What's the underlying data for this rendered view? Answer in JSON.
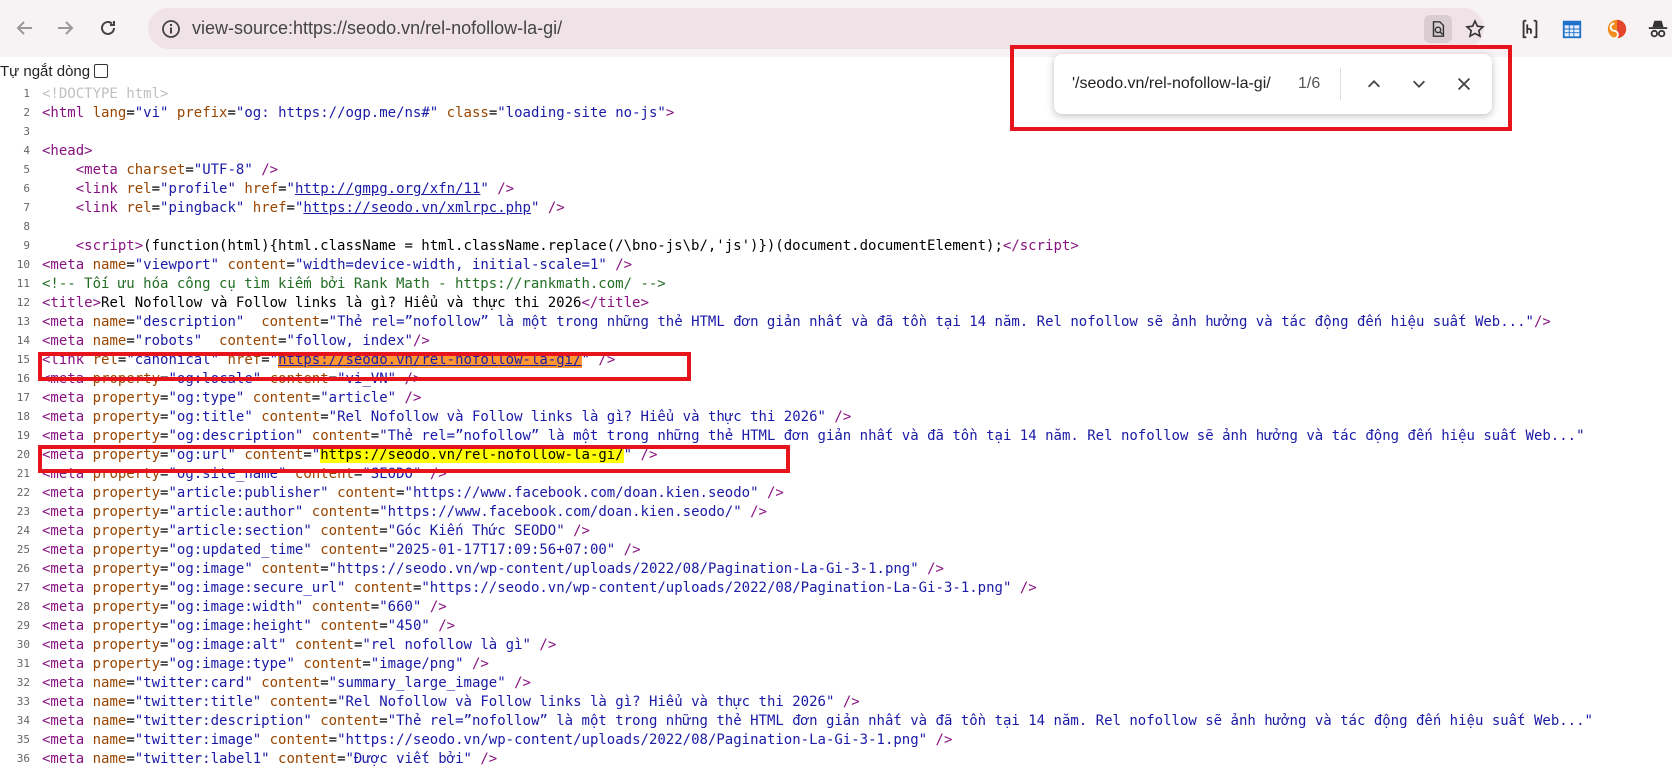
{
  "browser": {
    "url": "view-source:https://seodo.vn/rel-nofollow-la-gi/"
  },
  "wrap": {
    "label": "Tự ngắt dòng"
  },
  "find_bar": {
    "query": "'/seodo.vn/rel-nofollow-la-gi/",
    "count": "1/6"
  },
  "source": {
    "line_numbers": [
      "1",
      "2",
      "3",
      "4",
      "5",
      "6",
      "7",
      "8",
      "9",
      "10",
      "11",
      "12",
      "13",
      "14",
      "15",
      "16",
      "17",
      "18",
      "19",
      "20",
      "21",
      "22",
      "23",
      "24",
      "25",
      "26",
      "27",
      "28",
      "29",
      "30",
      "31",
      "32",
      "33",
      "34",
      "35",
      "36"
    ],
    "l1": "<!DOCTYPE html>",
    "l2_lang": "\"vi\"",
    "l2_prefix": "\"og: https://ogp.me/ns#\"",
    "l2_class": "\"loading-site no-js\"",
    "l5_charset": "\"UTF-8\"",
    "l6_rel": "\"profile\"",
    "l6_href": "http://gmpg.org/xfn/11",
    "l7_rel": "\"pingback\"",
    "l7_href": "https://seodo.vn/xmlrpc.php",
    "l9_script": "(function(html){html.className = html.className.replace(/\\bno-js\\b/,'js')})(document.documentElement);",
    "l10_name": "\"viewport\"",
    "l10_content": "\"width=device-width, initial-scale=1\"",
    "l11_comment": "<!-- Tối ưu hóa công cụ tìm kiếm bởi Rank Math - https://rankmath.com/ -->",
    "l12_title": "Rel Nofollow và Follow links là gì? Hiểu và thực thi 2026",
    "l13_name": "\"description\"",
    "l13_content": "\"Thẻ rel=”nofollow” là một trong những thẻ HTML đơn giản nhất và đã tồn tại 14 năm. Rel nofollow sẽ ảnh hưởng và tác động đến hiệu suất Web...\"",
    "l14_name": "\"robots\"",
    "l14_content": "\"follow, index\"",
    "l15_rel": "\"canonical\"",
    "l15_href": "https://seodo.vn/rel-nofollow-la-gi/",
    "l16_prop": "\"og:locale\"",
    "l16_content": "\"vi_VN\"",
    "l17_prop": "\"og:type\"",
    "l17_content": "\"article\"",
    "l18_prop": "\"og:title\"",
    "l18_content": "\"Rel Nofollow và Follow links là gì? Hiểu và thực thi 2026\"",
    "l19_prop": "\"og:description\"",
    "l19_content": "\"Thẻ rel=”nofollow” là một trong những thẻ HTML đơn giản nhất và đã tồn tại 14 năm. Rel nofollow sẽ ảnh hưởng và tác động đến hiệu suất Web...\"",
    "l20_prop": "\"og:url\"",
    "l20_content": "https://seodo.vn/rel-nofollow-la-gi/",
    "l21_prop": "\"og:site_name\"",
    "l21_content": "\"SEODO\"",
    "l22_prop": "\"article:publisher\"",
    "l22_content": "\"https://www.facebook.com/doan.kien.seodo\"",
    "l23_prop": "\"article:author\"",
    "l23_content": "\"https://www.facebook.com/doan.kien.seodo/\"",
    "l24_prop": "\"article:section\"",
    "l24_content": "\"Góc Kiến Thức SEODO\"",
    "l25_prop": "\"og:updated_time\"",
    "l25_content": "\"2025-01-17T17:09:56+07:00\"",
    "l26_prop": "\"og:image\"",
    "l26_content": "\"https://seodo.vn/wp-content/uploads/2022/08/Pagination-La-Gi-3-1.png\"",
    "l27_prop": "\"og:image:secure_url\"",
    "l27_content": "\"https://seodo.vn/wp-content/uploads/2022/08/Pagination-La-Gi-3-1.png\"",
    "l28_prop": "\"og:image:width\"",
    "l28_content": "\"660\"",
    "l29_prop": "\"og:image:height\"",
    "l29_content": "\"450\"",
    "l30_prop": "\"og:image:alt\"",
    "l30_content": "\"rel nofollow là gì\"",
    "l31_prop": "\"og:image:type\"",
    "l31_content": "\"image/png\"",
    "l32_name": "\"twitter:card\"",
    "l32_content": "\"summary_large_image\"",
    "l33_name": "\"twitter:title\"",
    "l33_content": "\"Rel Nofollow và Follow links là gì? Hiểu và thực thi 2026\"",
    "l34_name": "\"twitter:description\"",
    "l34_content": "\"Thẻ rel=”nofollow” là một trong những thẻ HTML đơn giản nhất và đã tồn tại 14 năm. Rel nofollow sẽ ảnh hưởng và tác động đến hiệu suất Web...\"",
    "l35_name": "\"twitter:image\"",
    "l35_content": "\"https://seodo.vn/wp-content/uploads/2022/08/Pagination-La-Gi-3-1.png\"",
    "l36_name": "\"twitter:label1\"",
    "l36_content": "\"Được viết bởi\""
  }
}
